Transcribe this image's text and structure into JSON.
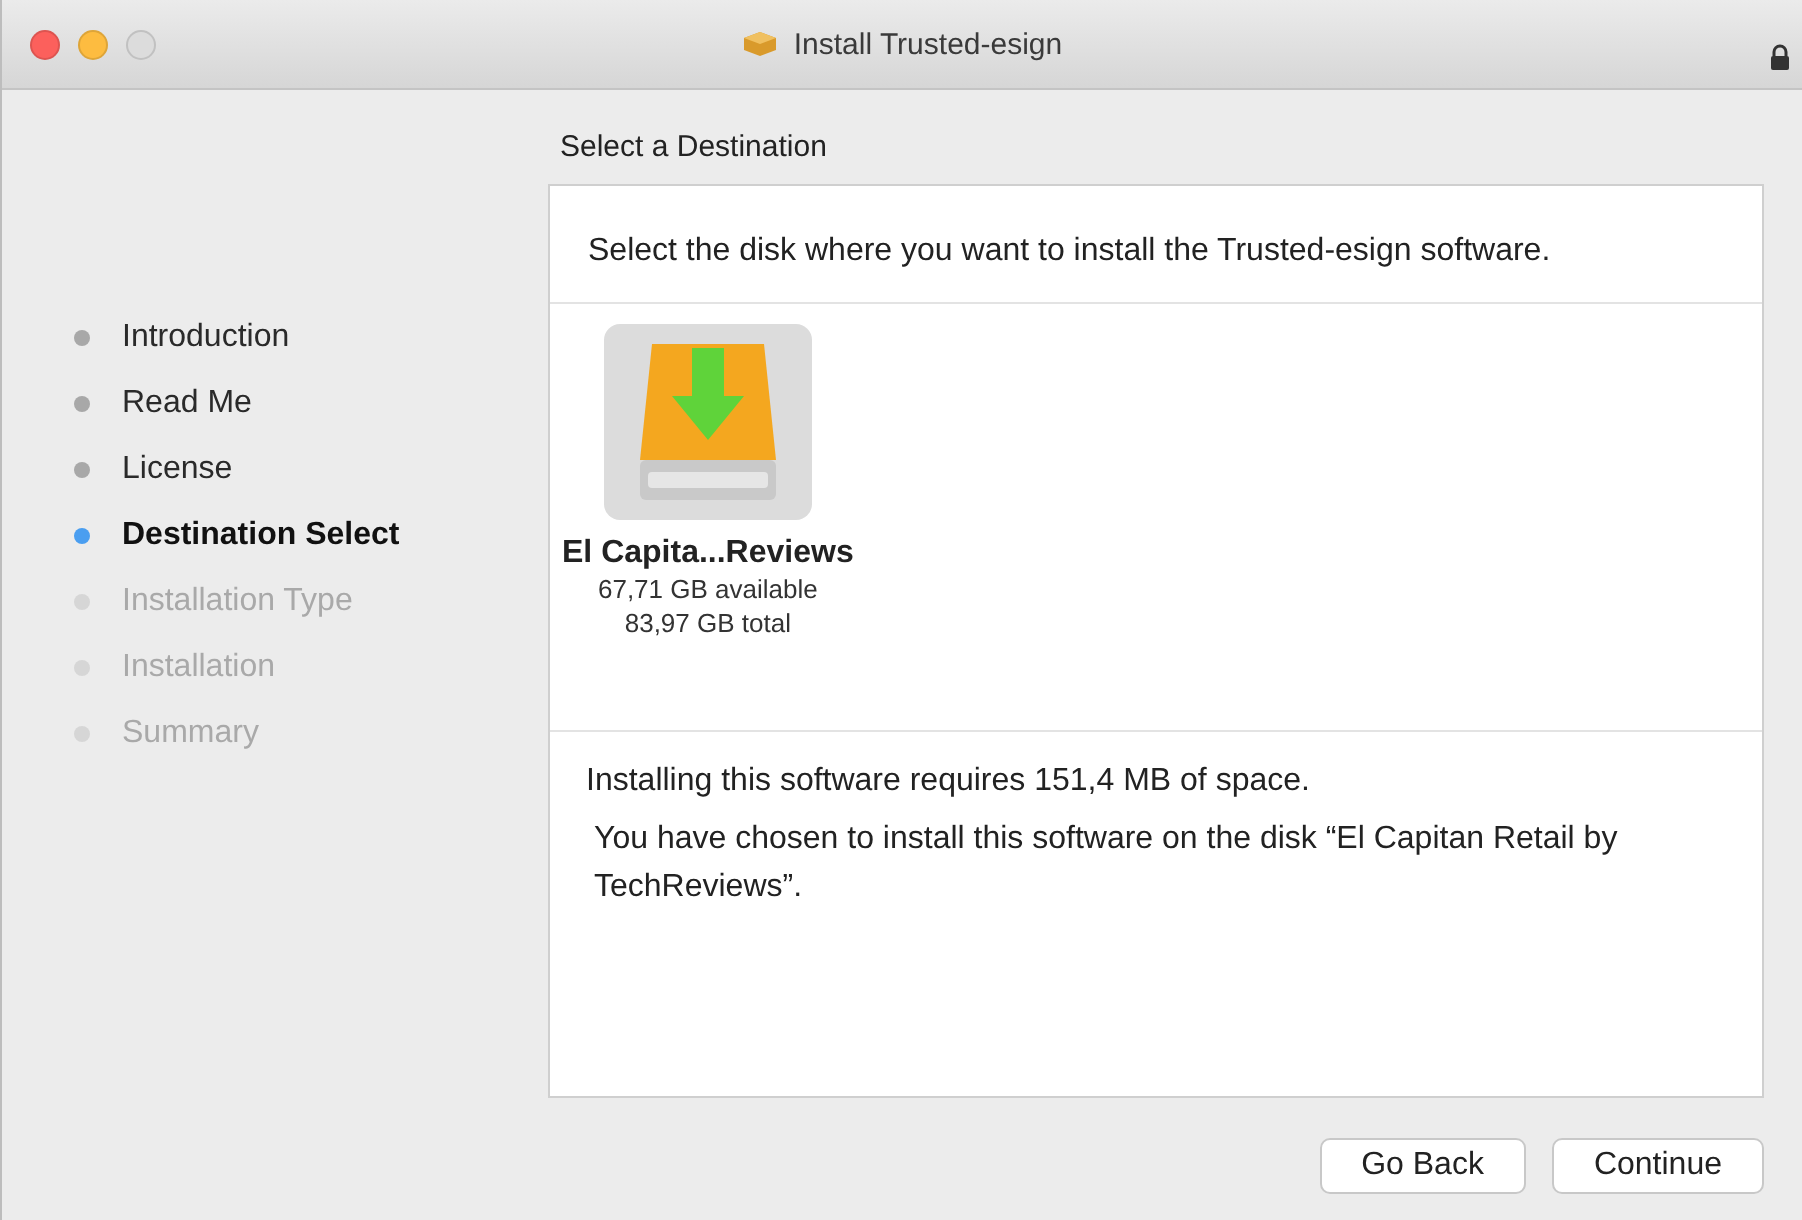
{
  "window": {
    "title": "Install Trusted-esign"
  },
  "steps": [
    {
      "label": "Introduction",
      "selected": false,
      "disabled": false
    },
    {
      "label": "Read Me",
      "selected": false,
      "disabled": false
    },
    {
      "label": "License",
      "selected": false,
      "disabled": false
    },
    {
      "label": "Destination Select",
      "selected": true,
      "disabled": false
    },
    {
      "label": "Installation Type",
      "selected": false,
      "disabled": true
    },
    {
      "label": "Installation",
      "selected": false,
      "disabled": true
    },
    {
      "label": "Summary",
      "selected": false,
      "disabled": true
    }
  ],
  "heading": "Select a Destination",
  "prompt": "Select the disk where you want to install the Trusted-esign software.",
  "disks": [
    {
      "name": "El Capita...Reviews",
      "available": "67,71 GB available",
      "total": "83,97 GB total",
      "selected": true
    }
  ],
  "requirement": "Installing this software requires 151,4 MB of space.",
  "choice": "You have chosen to install this software on the disk “El Capitan Retail by TechReviews”.",
  "buttons": [
    "Go Back",
    "Continue"
  ]
}
